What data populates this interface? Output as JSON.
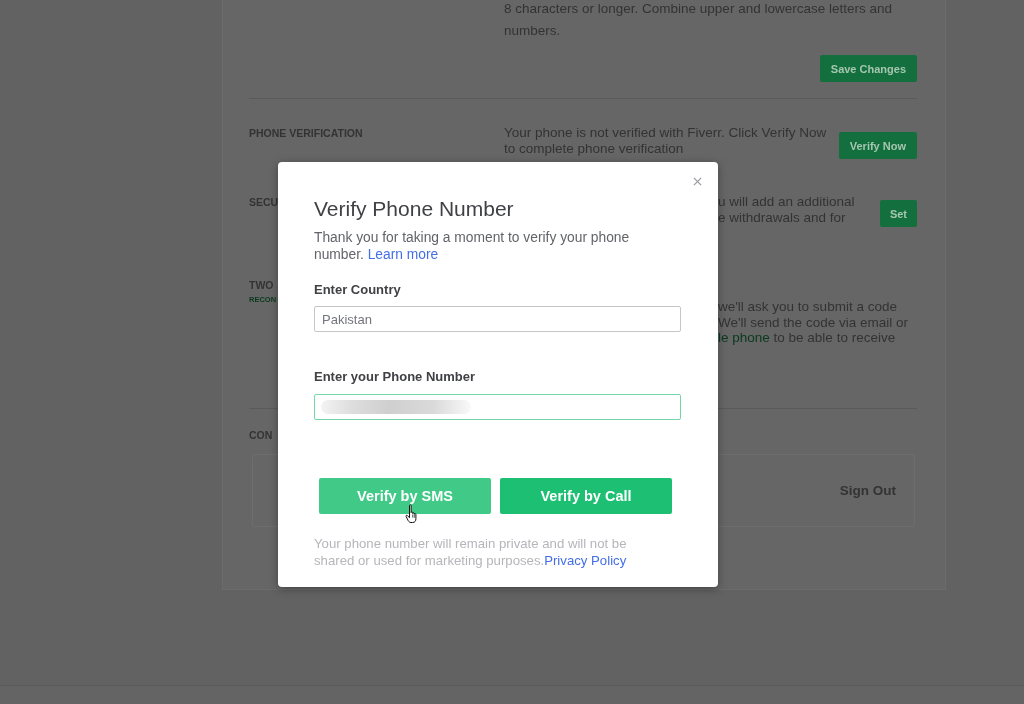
{
  "settings_page": {
    "password_hint": "8 characters or longer. Combine upper and lowercase letters and numbers.",
    "save_button": "Save Changes",
    "rows": [
      {
        "kind": "full",
        "label": "PHONE VERIFICATION",
        "text": "Your phone is not verified with Fiverr. Click Verify Now to complete phone verification",
        "button": "Verify Now"
      },
      {
        "kind": "partial",
        "label": "SECU",
        "lines": [
          {
            "text": "u will add an additional"
          },
          {
            "text": "e withdrawals and for"
          }
        ],
        "button": "Set"
      },
      {
        "kind": "partial",
        "label": "TWO",
        "badge": "RECON",
        "lines": [
          {
            "text": "we'll ask you to submit a code"
          },
          {
            "text": "We'll send the code via email or"
          },
          {
            "link": "le phone",
            "text": "to be able to receive"
          }
        ]
      }
    ],
    "section_label": "CON",
    "sign_out": "Sign Out"
  },
  "modal": {
    "title": "Verify Phone Number",
    "description": "Thank you for taking a moment to verify your phone number.",
    "learn_more": "Learn more",
    "country": {
      "label": "Enter Country",
      "value": "Pakistan"
    },
    "phone": {
      "label": "Enter your Phone Number",
      "focused": true
    },
    "buttons": [
      {
        "label": "Verify by SMS",
        "hovered": true
      },
      {
        "label": "Verify by Call",
        "hovered": false
      }
    ],
    "note": "Your phone number will remain private and will not be shared or used for marketing purposes.",
    "privacy_link": "Privacy Policy"
  }
}
